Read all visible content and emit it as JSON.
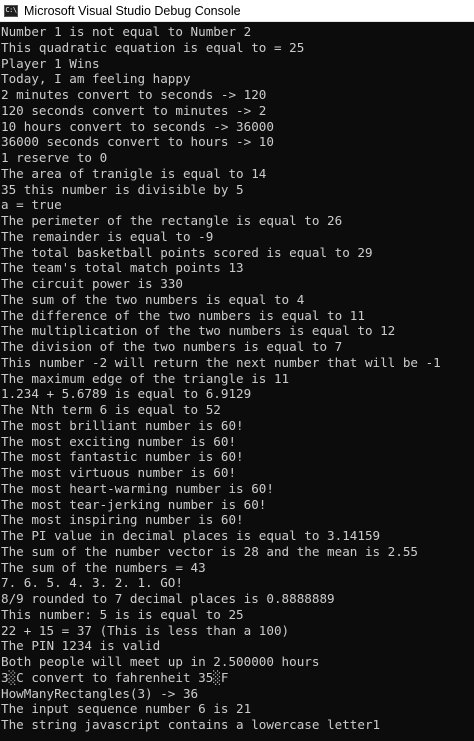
{
  "window": {
    "icon_glyph": "C:\\",
    "title": "Microsoft Visual Studio Debug Console"
  },
  "console": {
    "lines": [
      "Number 1 is not equal to Number 2",
      "This quadratic equation is equal to = 25",
      "Player 1 Wins",
      "Today, I am feeling happy",
      "2 minutes convert to seconds -> 120",
      "120 seconds convert to minutes -> 2",
      "10 hours convert to seconds -> 36000",
      "36000 seconds convert to hours -> 10",
      "1 reserve to 0",
      "The area of tranigle is equal to 14",
      "35 this number is divisible by 5",
      "a = true",
      "The perimeter of the rectangle is equal to 26",
      "The remainder is equal to -9",
      "The total basketball points scored is equal to 29",
      "The team's total match points 13",
      "The circuit power is 330",
      "The sum of the two numbers is equal to 4",
      "The difference of the two numbers is equal to 11",
      "The multiplication of the two numbers is equal to 12",
      "The division of the two numbers is equal to 7",
      "This number -2 will return the next number that will be -1",
      "The maximum edge of the triangle is 11",
      "1.234 + 5.6789 is equal to 6.9129",
      "The Nth term 6 is equal to 52",
      "The most brilliant number is 60!",
      "The most exciting number is 60!",
      "The most fantastic number is 60!",
      "The most virtuous number is 60!",
      "The most heart-warming number is 60!",
      "The most tear-jerking number is 60!",
      "The most inspiring number is 60!",
      "The PI value in decimal places is equal to 3.14159",
      "The sum of the number vector is 28 and the mean is 2.55",
      "The sum of the numbers = 43",
      "7. 6. 5. 4. 3. 2. 1. GO!",
      "8/9 rounded to 7 decimal places is 0.8888889",
      "This number: 5 is is equal to 25",
      "22 + 15 = 37 (This is less than a 100)",
      "The PIN 1234 is valid",
      "Both people will meet up in 2.500000 hours",
      "3░C convert to fahrenheit 35░F",
      "HowManyRectangles(3) -> 36",
      "The input sequence number 6 is 21",
      "The string javascript contains a lowercase letter1"
    ]
  }
}
